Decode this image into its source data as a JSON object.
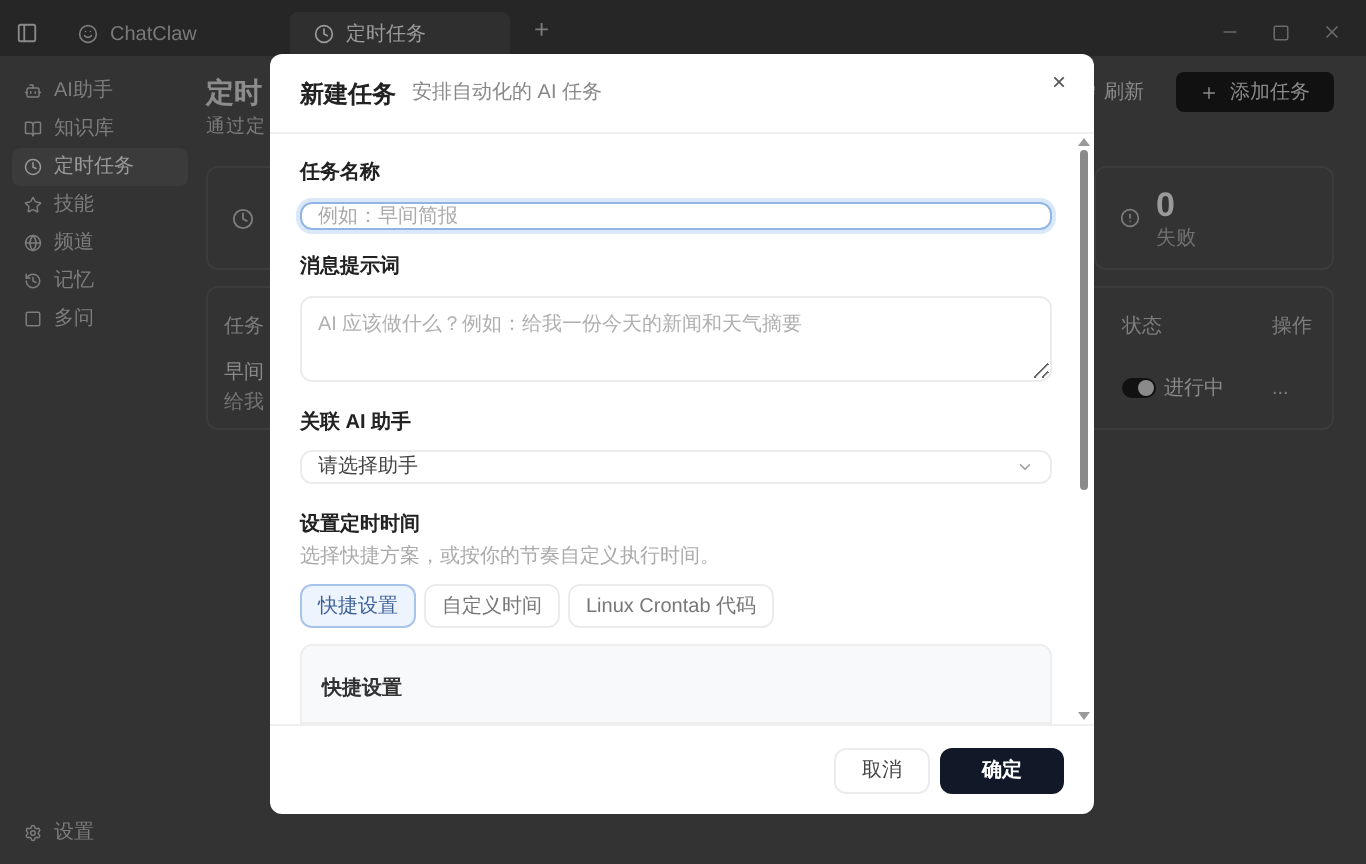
{
  "titlebar": {
    "tabs": [
      {
        "label": "ChatClaw",
        "kind": "app",
        "selected": false
      },
      {
        "label": "定时任务",
        "kind": "page",
        "selected": true
      }
    ],
    "new_tab": "+"
  },
  "sidebar": {
    "items": [
      {
        "label": "AI助手",
        "selected": false
      },
      {
        "label": "知识库",
        "selected": false
      },
      {
        "label": "定时任务",
        "selected": true
      },
      {
        "label": "技能",
        "selected": false
      },
      {
        "label": "频道",
        "selected": false
      },
      {
        "label": "记忆",
        "selected": false
      },
      {
        "label": "多问",
        "selected": false
      }
    ],
    "settings": "设置"
  },
  "page": {
    "title": "定时",
    "subtitle": "通过定",
    "refresh": "刷新",
    "add": "添加任务",
    "stats": [
      {
        "value": "0",
        "label": "失败"
      }
    ],
    "table": {
      "columns": [
        "任务",
        "状态",
        "操作"
      ],
      "rows": [
        {
          "name": "早间",
          "detail": "给我",
          "enabled": true,
          "status": "进行中",
          "action": "..."
        }
      ]
    }
  },
  "dialog": {
    "title": "新建任务",
    "subtitle": "安排自动化的 AI 任务",
    "close": "×",
    "name_label": "任务名称",
    "name_placeholder": "例如：早间简报",
    "prompt_label": "消息提示词",
    "prompt_placeholder": "AI 应该做什么？例如：给我一份今天的新闻和天气摘要",
    "assistant_label": "关联 AI 助手",
    "assistant_value": "请选择助手",
    "schedule_label": "设置定时时间",
    "schedule_hint": "选择快捷方案，或按你的节奏自定义执行时间。",
    "modes": [
      {
        "label": "快捷设置",
        "selected": true
      },
      {
        "label": "自定义时间",
        "selected": false
      },
      {
        "label": "Linux Crontab 代码",
        "selected": false
      }
    ],
    "panel_title": "快捷设置",
    "cancel": "取消",
    "confirm": "确定"
  }
}
